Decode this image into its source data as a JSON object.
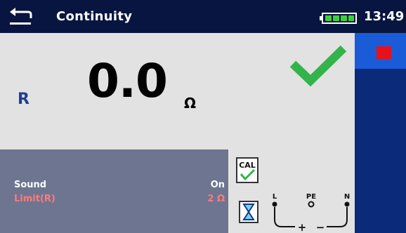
{
  "header": {
    "title": "Continuity",
    "time": "13:49",
    "battery_level": 1.0
  },
  "measurement": {
    "label": "R",
    "value": "0.0",
    "unit": "Ω",
    "result": "pass"
  },
  "params": [
    {
      "label": "Sound",
      "value": "On"
    },
    {
      "label": "Limit(R)",
      "value": "2 Ω"
    }
  ],
  "aux": {
    "cal_label": "CAL"
  },
  "terminals": {
    "left": "L",
    "middle": "PE",
    "right": "N",
    "plus": "+",
    "minus": "−"
  },
  "colors": {
    "header_bg": "#081540",
    "accent_blue": "#1d3e9a",
    "pass_green": "#33b34a",
    "stop_red": "#e8101a",
    "limit_text": "#ff7a7a"
  },
  "icons": [
    "back-icon",
    "battery-icon",
    "check-icon",
    "stop-icon",
    "cal-icon",
    "hourglass-icon"
  ]
}
